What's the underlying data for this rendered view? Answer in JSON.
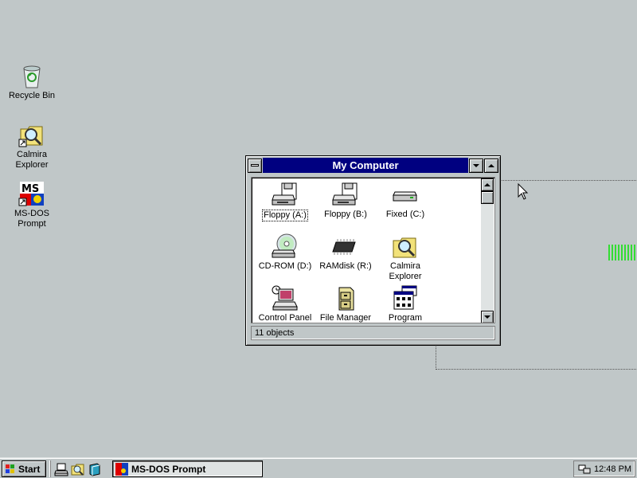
{
  "desktop": {
    "icons": [
      {
        "label": "Recycle Bin",
        "icon": "recycle-bin-icon"
      },
      {
        "label": "Calmira Explorer",
        "icon": "magnifier-folder-icon"
      },
      {
        "label": "MS-DOS Prompt",
        "icon": "msdos-icon"
      }
    ]
  },
  "window": {
    "title": "My Computer",
    "items": [
      {
        "label": "Floppy (A:)",
        "icon": "floppy-drive-icon"
      },
      {
        "label": "Floppy (B:)",
        "icon": "floppy-drive-icon"
      },
      {
        "label": "Fixed (C:)",
        "icon": "hard-drive-icon"
      },
      {
        "label": "CD-ROM (D:)",
        "icon": "cdrom-icon"
      },
      {
        "label": "RAMdisk (R:)",
        "icon": "ram-chip-icon"
      },
      {
        "label": "Calmira Explorer",
        "icon": "magnifier-folder-icon"
      },
      {
        "label": "Control Panel",
        "icon": "control-panel-icon"
      },
      {
        "label": "File Manager",
        "icon": "file-cabinet-icon"
      },
      {
        "label": "Program Manager",
        "icon": "program-manager-icon"
      }
    ],
    "status": "11 objects"
  },
  "taskbar": {
    "start_label": "Start",
    "task_label": "MS-DOS Prompt",
    "clock": "12:48 PM"
  },
  "colors": {
    "desktop": "#c0c7c8",
    "titlebar": "#000080"
  }
}
